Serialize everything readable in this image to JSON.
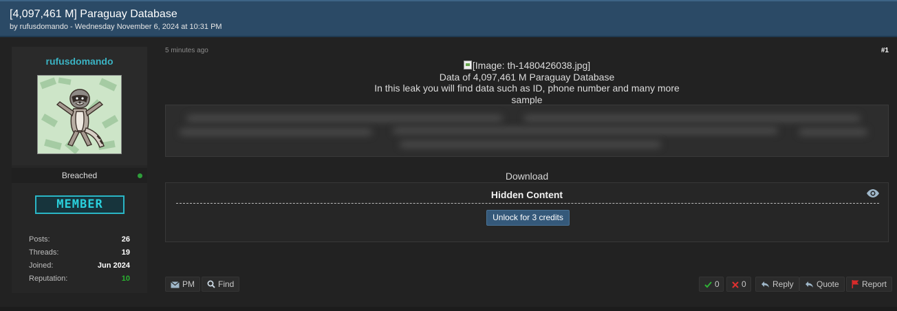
{
  "thread": {
    "title": "[4,097,461 M] Paraguay Database",
    "byline": "by rufusdomando - Wednesday November 6, 2024 at 10:31 PM"
  },
  "author": {
    "username": "rufusdomando",
    "avatar_icon": "raccoon-avatar",
    "status": "Breached",
    "rank": "MEMBER",
    "stats": {
      "posts_label": "Posts:",
      "posts": "26",
      "threads_label": "Threads:",
      "threads": "19",
      "joined_label": "Joined:",
      "joined": "Jun 2024",
      "reputation_label": "Reputation:",
      "reputation": "10"
    }
  },
  "post": {
    "time_ago": "5 minutes ago",
    "number": "#1",
    "image_alt": "[Image: th-1480426038.jpg]",
    "line1": "Data of 4,097,461 M Paraguay Database",
    "line2": "In this leak you will find data such as ID, phone number and many more",
    "line3": "sample",
    "download_label": "Download",
    "hidden_title": "Hidden Content",
    "unlock_label": "Unlock for 3 credits"
  },
  "actions": {
    "pm": "PM",
    "find": "Find",
    "likes": "0",
    "dislikes": "0",
    "reply": "Reply",
    "quote": "Quote",
    "report": "Report"
  },
  "colors": {
    "header_bg": "#2b4a66",
    "username": "#3bb3c3",
    "rank": "#2ad0dc",
    "reputation": "#29b32f",
    "unlock_btn": "#35597a"
  }
}
